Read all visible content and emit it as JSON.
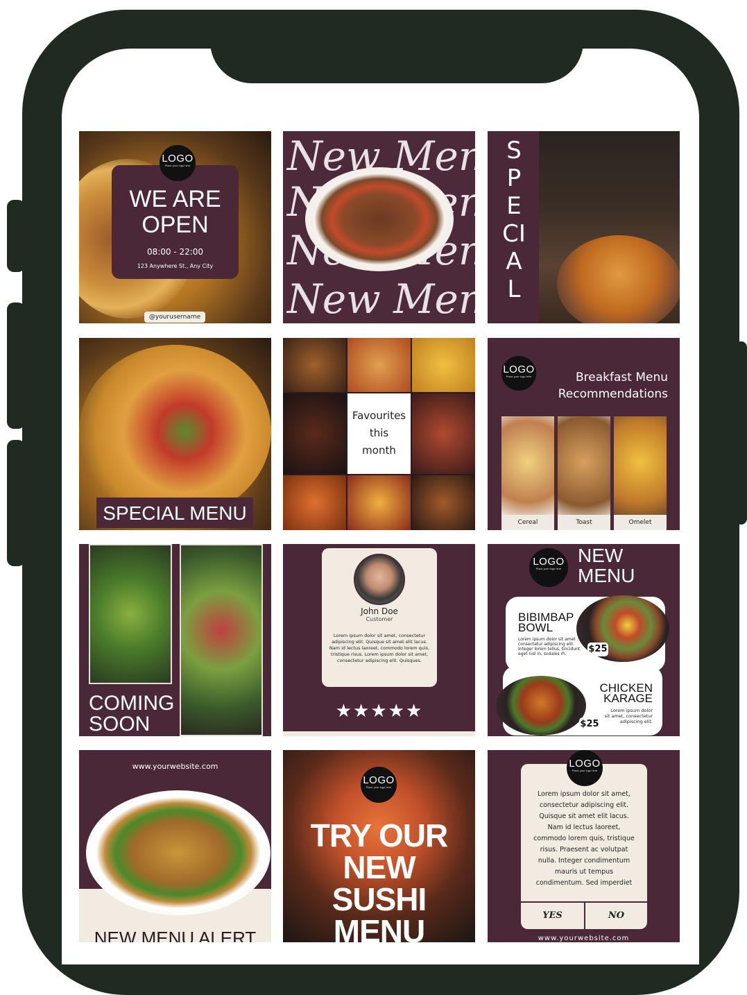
{
  "tiles": {
    "open": {
      "logo": "LOGO",
      "logo_sub": "Place your logo here",
      "title_1": "WE ARE",
      "title_2": "OPEN",
      "hours": "08:00 - 22:00",
      "address": "123 Anywhere St., Any City",
      "username": "@yourusername"
    },
    "new_menu_script": {
      "row1": "New Menu",
      "row2": "New Menu",
      "row3": "New Menu",
      "row4": "New Menu"
    },
    "special": {
      "vertical_text": "SPECIAL"
    },
    "special_menu": {
      "banner": "SPECIAL MENU"
    },
    "favourites": {
      "line1": "Favourites",
      "line2": "this",
      "line3": "month"
    },
    "breakfast": {
      "logo": "LOGO",
      "logo_sub": "Place your logo here",
      "title_1": "Breakfast Menu",
      "title_2": "Recommendations",
      "items": [
        "Cereal",
        "Toast",
        "Omelet"
      ]
    },
    "coming_soon": {
      "line1": "COMING",
      "line2": "SOON"
    },
    "testimonial": {
      "name": "John Doe",
      "role": "Customer",
      "text": "Lorem ipsum dolor sit amet, consectetur adipiscing elit. Quisque sit amet elit lacus. Nam id lectus laoreet, commodo lorem quis, tristique risus. Lorem ipsum dolor sit amet, consectetur adipiscing elit. Quisques.",
      "stars": "★★★★★"
    },
    "new_menu_items": {
      "logo": "LOGO",
      "logo_sub": "Place your logo here",
      "title_1": "NEW",
      "title_2": "MENU",
      "item1_name_1": "BIBIMBAP",
      "item1_name_2": "BOWL",
      "item1_desc": "Lorem ipsum dolor sit amet consectetur adipiscing elit. Integer lorem tellus, tincidunt eget nisl in, sodales rh.",
      "item1_price": "$25",
      "item2_name_1": "CHICKEN",
      "item2_name_2": "KARAGE",
      "item2_desc": "Lorem ipsum dolor sit amet, consectetur adipiscing elit.",
      "item2_price": "$25"
    },
    "alert": {
      "website": "www.yourwebsite.com",
      "title": "NEW MENU ALERT"
    },
    "sushi": {
      "logo": "LOGO",
      "logo_sub": "Place your logo here",
      "line1": "TRY OUR",
      "line2": "NEW",
      "line3": "SUSHI MENU"
    },
    "poll": {
      "logo": "LOGO",
      "logo_sub": "Place your logo here",
      "text": "Lorem ipsum dolor sit amet, consectetur adipiscing elit. Quisque sit amet elit lacus. Nam id lectus laoreet, commodo lorem quis, tristique risus. Praesent ac volutpat nulla. Integer condimentum mauris ut tempus condimentum. Sed imperdiet",
      "yes": "YES",
      "no": "NO",
      "website": "www.yourwebsite.com"
    }
  }
}
